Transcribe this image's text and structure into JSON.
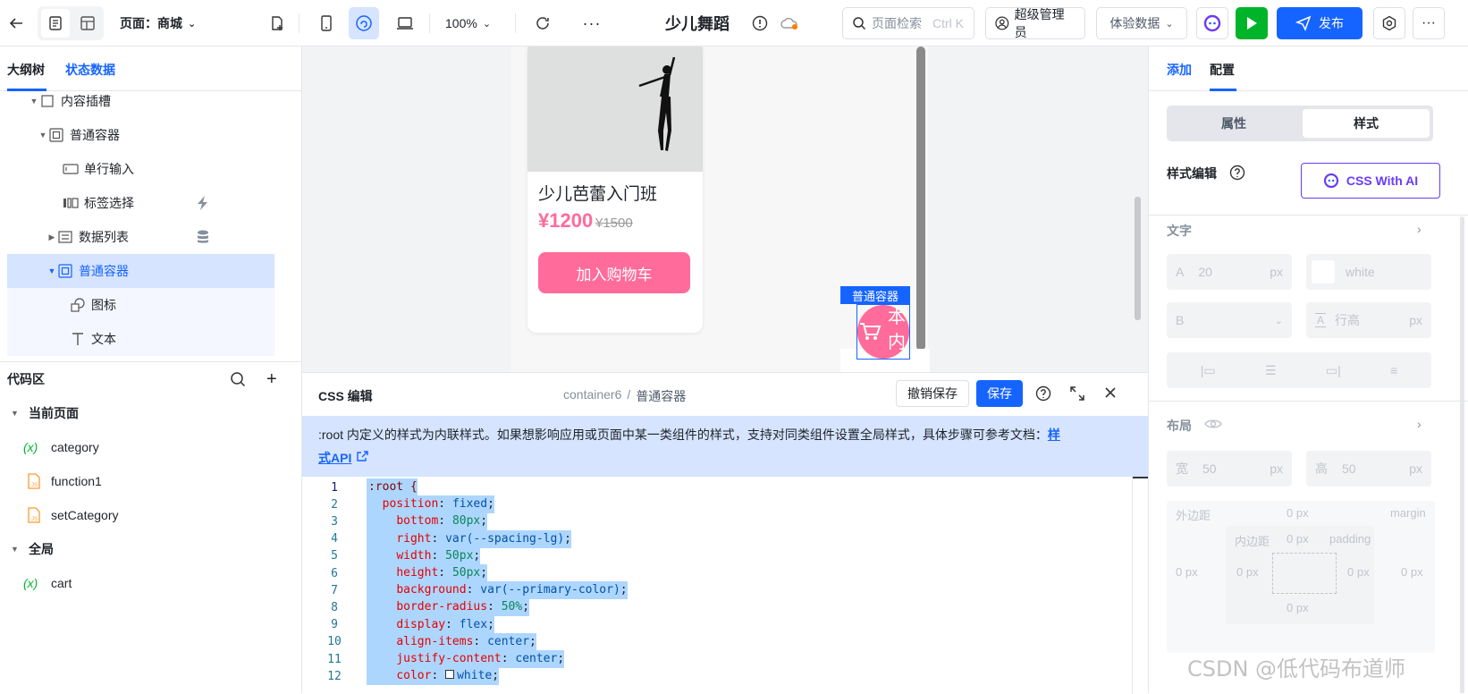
{
  "topbar": {
    "page_label": "页面：商城",
    "zoom": "100%",
    "app_title": "少儿舞蹈",
    "search_placeholder": "页面检索",
    "search_shortcut": "Ctrl K",
    "user": "超级管理员",
    "data_mode": "体验数据",
    "publish": "发布"
  },
  "left_panel": {
    "tabs": [
      "大纲树",
      "状态数据"
    ],
    "tree": [
      {
        "label": "内容插槽",
        "icon": "slot-icon"
      },
      {
        "label": "普通容器",
        "icon": "container-icon"
      },
      {
        "label": "单行输入",
        "icon": "input-icon"
      },
      {
        "label": "标签选择",
        "icon": "tag-select-icon"
      },
      {
        "label": "数据列表",
        "icon": "list-icon"
      },
      {
        "label": "普通容器",
        "icon": "container-icon"
      },
      {
        "label": "图标",
        "icon": "shapes-icon"
      },
      {
        "label": "文本",
        "icon": "text-icon"
      }
    ],
    "code_title": "代码区",
    "current_page": "当前页面",
    "page_items": [
      "category",
      "function1",
      "setCategory"
    ],
    "global": "全局",
    "global_items": [
      "cart"
    ]
  },
  "canvas": {
    "product_name": "少儿芭蕾入门班",
    "price": "¥1200",
    "old_price": "¥1500",
    "add_cart": "加入购物车",
    "selected_tag": "普通容器",
    "cart_badge_chars": "本\n内"
  },
  "editor": {
    "title": "CSS 编辑",
    "crumb_parent": "container6",
    "crumb_sep": "/",
    "crumb_current": "普通容器",
    "undo": "撤销保存",
    "save": "保存",
    "notice": ":root 内定义的样式为内联样式。如果想影响应用或页面中某一类组件的样式，支持对同类组件设置全局样式，具体步骤可参考文档：",
    "notice_link_1": "样",
    "notice_link_2": "式API",
    "code": [
      [
        {
          "t": ":root {",
          "c": "sel"
        }
      ],
      [
        {
          "t": "  "
        },
        {
          "t": "position",
          "c": "prop"
        },
        {
          "t": ": "
        },
        {
          "t": "fixed",
          "c": "val"
        },
        {
          "t": ";"
        }
      ],
      [
        {
          "t": "    "
        },
        {
          "t": "bottom",
          "c": "prop"
        },
        {
          "t": ": "
        },
        {
          "t": "80px",
          "c": "num"
        },
        {
          "t": ";"
        }
      ],
      [
        {
          "t": "    "
        },
        {
          "t": "right",
          "c": "prop"
        },
        {
          "t": ": "
        },
        {
          "t": "var(--spacing-lg)",
          "c": "val"
        },
        {
          "t": ";"
        }
      ],
      [
        {
          "t": "    "
        },
        {
          "t": "width",
          "c": "prop"
        },
        {
          "t": ": "
        },
        {
          "t": "50px",
          "c": "num"
        },
        {
          "t": ";"
        }
      ],
      [
        {
          "t": "    "
        },
        {
          "t": "height",
          "c": "prop"
        },
        {
          "t": ": "
        },
        {
          "t": "50px",
          "c": "num"
        },
        {
          "t": ";"
        }
      ],
      [
        {
          "t": "    "
        },
        {
          "t": "background",
          "c": "prop"
        },
        {
          "t": ": "
        },
        {
          "t": "var(--primary-color)",
          "c": "val"
        },
        {
          "t": ";"
        }
      ],
      [
        {
          "t": "    "
        },
        {
          "t": "border-radius",
          "c": "prop"
        },
        {
          "t": ": "
        },
        {
          "t": "50%",
          "c": "num"
        },
        {
          "t": ";"
        }
      ],
      [
        {
          "t": "    "
        },
        {
          "t": "display",
          "c": "prop"
        },
        {
          "t": ": "
        },
        {
          "t": "flex",
          "c": "val"
        },
        {
          "t": ";"
        }
      ],
      [
        {
          "t": "    "
        },
        {
          "t": "align-items",
          "c": "prop"
        },
        {
          "t": ": "
        },
        {
          "t": "center",
          "c": "val"
        },
        {
          "t": ";"
        }
      ],
      [
        {
          "t": "    "
        },
        {
          "t": "justify-content",
          "c": "prop"
        },
        {
          "t": ": "
        },
        {
          "t": "center",
          "c": "val"
        },
        {
          "t": ";"
        }
      ],
      [
        {
          "t": "    "
        },
        {
          "t": "color",
          "c": "prop"
        },
        {
          "t": ": "
        },
        {
          "t": "□",
          "c": "box"
        },
        {
          "t": "white",
          "c": "val"
        },
        {
          "t": ";"
        }
      ]
    ]
  },
  "right_panel": {
    "tabs": [
      "添加",
      "配置"
    ],
    "seg": [
      "属性",
      "样式"
    ],
    "style_edit": "样式编辑",
    "css_ai": "CSS With AI",
    "text_section": "文字",
    "font_size_label": "A",
    "font_size": "20",
    "unit_px": "px",
    "color_value": "white",
    "weight_label": "B",
    "line_height_label": "行高",
    "layout_section": "布局",
    "width_label": "宽",
    "width": "50",
    "height_label": "高",
    "height": "50",
    "margin_label": "外边距",
    "margin_en": "margin",
    "padding_label": "内边距",
    "padding_en": "padding",
    "zero_px": "0 px"
  },
  "watermark": "CSDN @低代码布道师",
  "colors": {
    "primary": "#1664ff",
    "pink": "#ff6b9a",
    "green": "#00b42a",
    "notice_bg": "#d6e4ff"
  }
}
